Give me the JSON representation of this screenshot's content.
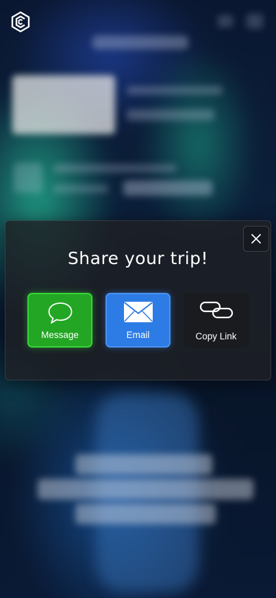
{
  "modal": {
    "title": "Share your trip!",
    "close_icon": "close-icon",
    "options": [
      {
        "label": "Message",
        "icon": "chat-bubble-icon",
        "color": "#23a624"
      },
      {
        "label": "Email",
        "icon": "envelope-icon",
        "color": "#2d7be4"
      },
      {
        "label": "Copy Link",
        "icon": "link-icon",
        "color": "#1a1b1e"
      }
    ]
  },
  "header": {
    "logo_icon": "app-logo-icon"
  }
}
